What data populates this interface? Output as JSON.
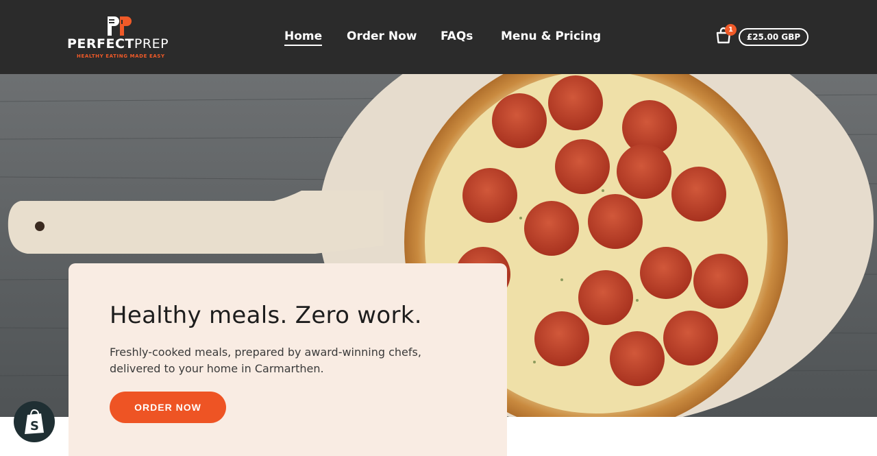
{
  "brand": {
    "name_bold": "PERFECT",
    "name_light": "PREP",
    "tagline": "HEALTHY EATING MADE EASY",
    "accent_color": "#f05a28",
    "icon": "pp-monogram-icon"
  },
  "nav": {
    "items": [
      {
        "label": "Home",
        "active": true
      },
      {
        "label": "Order Now",
        "active": false
      },
      {
        "label": "FAQs",
        "active": false
      },
      {
        "label": "Menu & Pricing",
        "active": false
      }
    ]
  },
  "cart": {
    "icon": "shopping-bag-icon",
    "count": "1",
    "total": "£25.00 GBP"
  },
  "hero": {
    "image": "pepperoni-pizza-on-wooden-peel",
    "title": "Healthy meals. Zero work.",
    "description": "Freshly-cooked meals, prepared by award-winning chefs, delivered to your home in Carmarthen.",
    "cta_label": "ORDER NOW",
    "cta_color": "#ee5424"
  },
  "shopify_badge": {
    "icon": "shopify-bag-icon"
  }
}
